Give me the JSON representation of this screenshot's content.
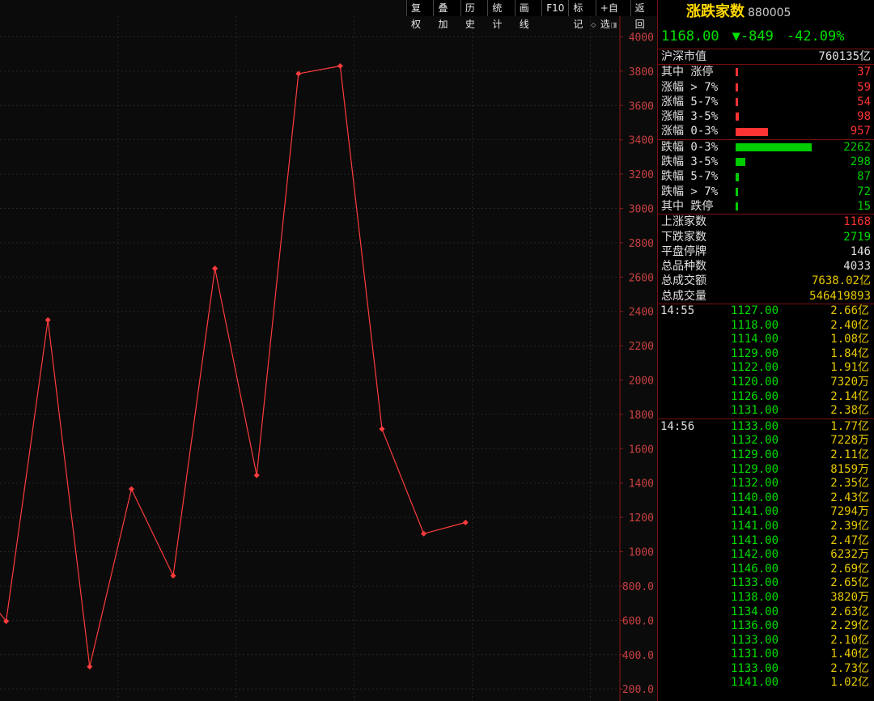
{
  "toolbar": [
    "复权",
    "叠加",
    "历史",
    "统计",
    "画线",
    "F10",
    "标记",
    "+自选",
    "返回"
  ],
  "corner_icons": "◇ ◨",
  "chart_data": {
    "type": "line",
    "title": "",
    "xlabel": "",
    "ylabel": "",
    "ylim": [
      130,
      4120
    ],
    "yticks": [
      200,
      400,
      600,
      800,
      1000,
      1200,
      1400,
      1600,
      1800,
      2000,
      2200,
      2400,
      2600,
      2800,
      3000,
      3200,
      3400,
      3600,
      3800,
      4000
    ],
    "ytick_labels": [
      "200.0",
      "400.0",
      "600.0",
      "800.0",
      "1000",
      "1200",
      "1400",
      "1600",
      "1800",
      "2000",
      "2200",
      "2400",
      "2600",
      "2800",
      "3000",
      "3200",
      "3400",
      "3600",
      "3800",
      "4000"
    ],
    "series": [
      {
        "color": "#ff3b3b",
        "values": [
          900,
          595,
          2350,
          330,
          1365,
          860,
          2650,
          1445,
          3785,
          3830,
          1715,
          1105,
          1170
        ]
      }
    ],
    "grid": true,
    "grid_color": "#262626",
    "axis_color": "#8b1a1a",
    "tick_color": "#c84040"
  },
  "panel": {
    "name": "涨跌家数",
    "code": "880005",
    "price": "1168.00",
    "change": "▼-849",
    "change_pct": "-42.09%",
    "market_cap_label": "沪深市值",
    "market_cap": "760135亿",
    "up_rows": [
      {
        "label": "其中 涨停",
        "value": "37",
        "bar": 37
      },
      {
        "label": "涨幅 > 7%",
        "value": "59",
        "bar": 59
      },
      {
        "label": "涨幅 5-7%",
        "value": "54",
        "bar": 54
      },
      {
        "label": "涨幅 3-5%",
        "value": "98",
        "bar": 98
      },
      {
        "label": "涨幅 0-3%",
        "value": "957",
        "bar": 957
      }
    ],
    "down_rows": [
      {
        "label": "跌幅 0-3%",
        "value": "2262",
        "bar": 2262
      },
      {
        "label": "跌幅 3-5%",
        "value": "298",
        "bar": 298
      },
      {
        "label": "跌幅 5-7%",
        "value": "87",
        "bar": 87
      },
      {
        "label": "跌幅 > 7%",
        "value": "72",
        "bar": 72
      },
      {
        "label": "其中 跌停",
        "value": "15",
        "bar": 15
      }
    ],
    "stats": [
      {
        "label": "上涨家数",
        "value": "1168",
        "color": "red"
      },
      {
        "label": "下跌家数",
        "value": "2719",
        "color": "green"
      },
      {
        "label": "平盘停牌",
        "value": "146",
        "color": "white"
      },
      {
        "label": "总品种数",
        "value": "4033",
        "color": "white"
      },
      {
        "label": "总成交额",
        "value": "7638.02亿",
        "color": "yellow"
      },
      {
        "label": "总成交量",
        "value": "546419893",
        "color": "yellow"
      }
    ],
    "ticks": [
      {
        "time": "14:55",
        "price": "1127.00",
        "vol": "2.66亿"
      },
      {
        "time": "",
        "price": "1118.00",
        "vol": "2.40亿"
      },
      {
        "time": "",
        "price": "1114.00",
        "vol": "1.08亿"
      },
      {
        "time": "",
        "price": "1129.00",
        "vol": "1.84亿"
      },
      {
        "time": "",
        "price": "1122.00",
        "vol": "1.91亿"
      },
      {
        "time": "",
        "price": "1120.00",
        "vol": "7320万"
      },
      {
        "time": "",
        "price": "1126.00",
        "vol": "2.14亿"
      },
      {
        "time": "",
        "price": "1131.00",
        "vol": "2.38亿"
      },
      {
        "time": "14:56",
        "price": "1133.00",
        "vol": "1.77亿"
      },
      {
        "time": "",
        "price": "1132.00",
        "vol": "7228万"
      },
      {
        "time": "",
        "price": "1129.00",
        "vol": "2.11亿"
      },
      {
        "time": "",
        "price": "1129.00",
        "vol": "8159万"
      },
      {
        "time": "",
        "price": "1132.00",
        "vol": "2.35亿"
      },
      {
        "time": "",
        "price": "1140.00",
        "vol": "2.43亿"
      },
      {
        "time": "",
        "price": "1141.00",
        "vol": "7294万"
      },
      {
        "time": "",
        "price": "1141.00",
        "vol": "2.39亿"
      },
      {
        "time": "",
        "price": "1141.00",
        "vol": "2.47亿"
      },
      {
        "time": "",
        "price": "1142.00",
        "vol": "6232万"
      },
      {
        "time": "",
        "price": "1146.00",
        "vol": "2.69亿"
      },
      {
        "time": "",
        "price": "1133.00",
        "vol": "2.65亿"
      },
      {
        "time": "",
        "price": "1138.00",
        "vol": "3820万"
      },
      {
        "time": "",
        "price": "1134.00",
        "vol": "2.63亿"
      },
      {
        "time": "",
        "price": "1136.00",
        "vol": "2.29亿"
      },
      {
        "time": "",
        "price": "1133.00",
        "vol": "2.10亿"
      },
      {
        "time": "",
        "price": "1131.00",
        "vol": "1.40亿"
      },
      {
        "time": "",
        "price": "1133.00",
        "vol": "2.73亿"
      },
      {
        "time": "",
        "price": "1141.00",
        "vol": "1.02亿"
      }
    ]
  }
}
